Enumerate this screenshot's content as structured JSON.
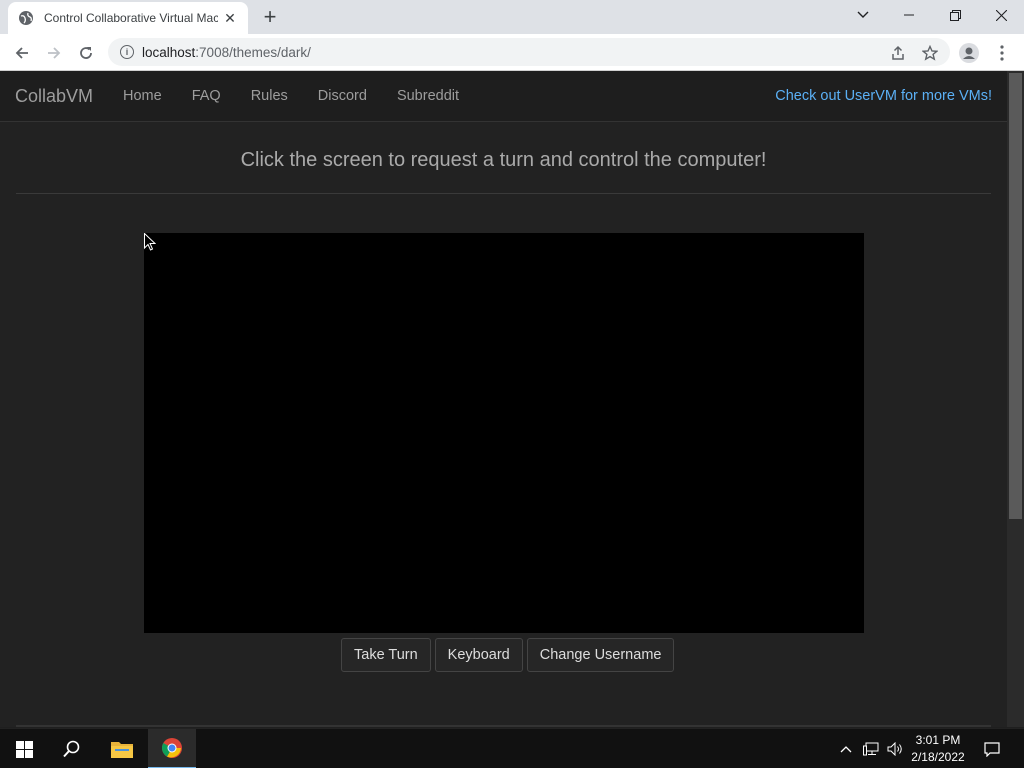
{
  "browser": {
    "tab_title": "Control Collaborative Virtual Machine",
    "url_host": "localhost",
    "url_rest": ":7008/themes/dark/"
  },
  "navbar": {
    "brand": "CollabVM",
    "links": [
      "Home",
      "FAQ",
      "Rules",
      "Discord",
      "Subreddit"
    ],
    "right_link": "Check out UserVM for more VMs!"
  },
  "main": {
    "headline": "Click the screen to request a turn and control the computer!",
    "buttons": {
      "take_turn": "Take Turn",
      "keyboard": "Keyboard",
      "change_username": "Change Username"
    }
  },
  "taskbar": {
    "time": "3:01 PM",
    "date": "2/18/2022"
  },
  "colors": {
    "accent_link": "#5bb0f5",
    "page_bg": "#222222",
    "vm_screen": "#000000"
  }
}
